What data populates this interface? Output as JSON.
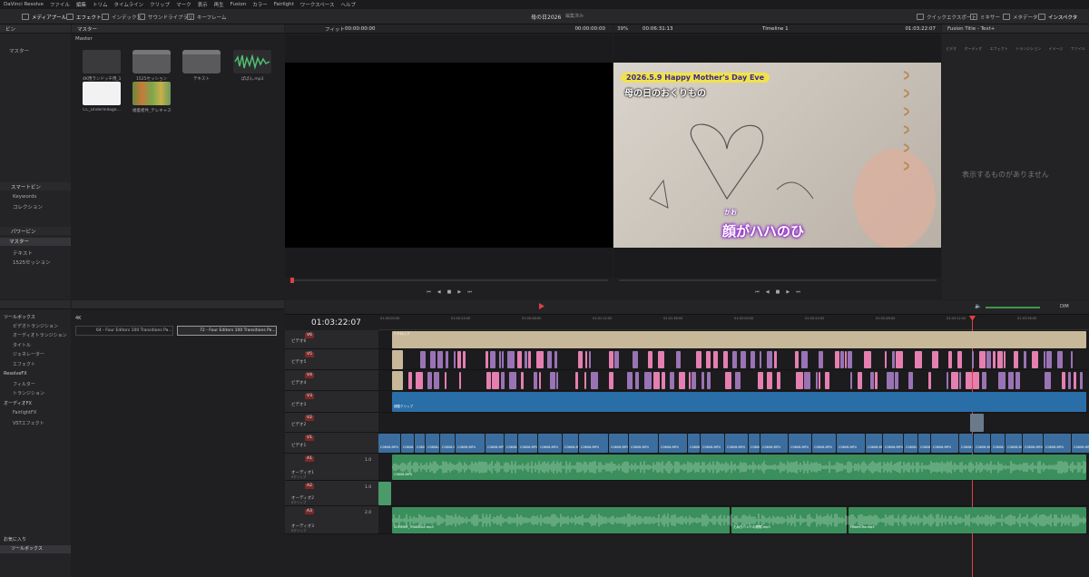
{
  "menu": [
    "DaVinci Resolve",
    "ファイル",
    "編集",
    "トリム",
    "タイムライン",
    "クリップ",
    "マーク",
    "表示",
    "再生",
    "Fusion",
    "カラー",
    "Fairlight",
    "ワークスペース",
    "ヘルプ"
  ],
  "toolbar": {
    "media_pool": "メディアプール",
    "effects": "エフェクト",
    "index": "インデックス",
    "sound_library": "サウンドライブラリ",
    "keyframe": "キーフレーム",
    "quick_export": "クイックエクスポート",
    "mixer": "ミキサー",
    "metadata": "メタデータ",
    "inspector": "インスペクタ"
  },
  "project": {
    "title": "母の日2026",
    "status": "編集済み"
  },
  "media_pool": {
    "header": "マスター",
    "bins_title": "ビン",
    "master": "マスター",
    "crumb": "Master",
    "smart_bins": "スマートビン",
    "keywords": "Keywords",
    "collections": "コレクション",
    "power_bins": "パワービン",
    "power_master": "マスター",
    "power_items": [
      "テキスト",
      "1525セッション"
    ],
    "clips": [
      {
        "label": "4K用ランドッチ用_1920"
      },
      {
        "label": "1525セッション"
      },
      {
        "label": "テキスト"
      },
      {
        "label": "ぱぱん.mp3"
      },
      {
        "label": "CC_UnderVillage..."
      },
      {
        "label": "褪着者件_テレキャス..."
      }
    ]
  },
  "source_viewer": {
    "zoom": "フィット",
    "tc_left": "00:00:00:00",
    "tc_right": "00:00:00:00"
  },
  "timeline_viewer": {
    "zoom": "39%",
    "tc_left": "00:06:31:13",
    "timeline": "Timeline 1",
    "tc_right": "01:03:22:07",
    "banner": "2026.5.9 Happy Mother's Day Eve",
    "caption": "母の日のおくりもの",
    "ruby": "かお",
    "subtitle": "顔がハハのひ"
  },
  "inspector": {
    "title": "Fusion Title - Text+",
    "tabs": [
      "ビデオ",
      "オーディオ",
      "エフェクト",
      "トランジション",
      "イメージ",
      "ファイル"
    ],
    "empty": "表示するものがありません"
  },
  "effects": {
    "header": "4K",
    "tree": [
      "ツールボックス",
      "ビデオトランジション",
      "オーディオトランジション",
      "タイトル",
      "ジェネレーター",
      "エフェクト",
      "ResolveFX",
      "フィルター",
      "トランジション",
      "オーディオFX",
      "FairlightFX",
      "VSTエフェクト"
    ],
    "favorites": "お気に入り",
    "fav_toolbox": "ツールボックス",
    "items": [
      "64 - Four Editors 100 Transitions Pa...",
      "72 - Four Editors 100 Transitions Pa..."
    ]
  },
  "timeline": {
    "timecode": "01:03:22:07",
    "audio_label": "DIM",
    "ruler": [
      "01:00:00:00",
      "01:00:24:00",
      "01:00:48:00",
      "01:01:12:00",
      "01:01:36:00",
      "01:02:00:00",
      "01:02:24:00",
      "01:02:48:00",
      "01:03:12:00",
      "01:03:36:00"
    ],
    "tracks": [
      {
        "id": "V6",
        "name": "ビデオ6"
      },
      {
        "id": "V5",
        "name": "ビデオ5"
      },
      {
        "id": "V4",
        "name": "ビデオ4"
      },
      {
        "id": "V3",
        "name": "ビデオ3"
      },
      {
        "id": "V2",
        "name": "ビデオ2"
      },
      {
        "id": "V1",
        "name": "ビデオ1"
      },
      {
        "id": "A1",
        "name": "オーディオ1",
        "sub": "0クリップ",
        "lvl": "1.0"
      },
      {
        "id": "A2",
        "name": "オーディオ2",
        "sub": "0クリップ",
        "lvl": "1.0"
      },
      {
        "id": "A3",
        "name": "オーディオ3",
        "sub": "0クリップ",
        "lvl": "2.0"
      }
    ],
    "clips": {
      "v6_text": "T テロップ",
      "v3_text": "調整クリップ",
      "v1_text": "C0606.MP4",
      "a3_1": "SUMMER_TRIANGLE.mp3",
      "a3_2": "たぬきバンドの歌歌.mp3",
      "a3_3": "Hitomi-Ha.mp3",
      "a1_text": "C0608.MP4"
    }
  },
  "colors": {
    "accent": "#e04040",
    "pink": "#e47fb0",
    "purple": "#9a73b4",
    "tan": "#c8b89a",
    "blue": "#2a6ea8",
    "green": "#3a8f5c",
    "yellow": "#f2e24a"
  }
}
